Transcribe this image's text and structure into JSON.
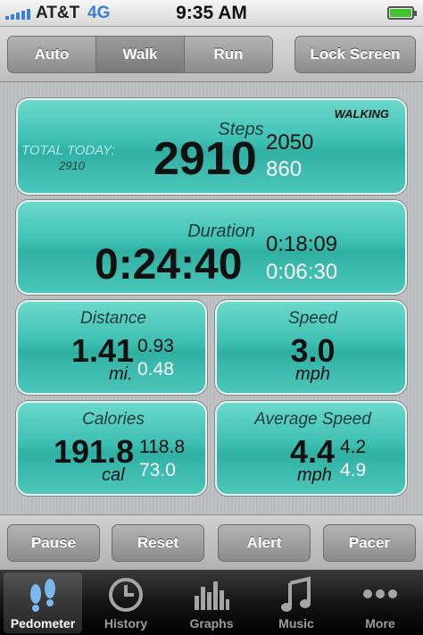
{
  "status_bar": {
    "carrier": "AT&T",
    "network": "4G",
    "time": "9:35 AM",
    "battery_level": 1.0
  },
  "mode_selector": {
    "options": [
      "Auto",
      "Walk",
      "Run"
    ],
    "selected": "Walk"
  },
  "lock_screen_label": "Lock Screen",
  "steps": {
    "label": "Steps",
    "status": "WALKING",
    "total_today_label": "TOTAL TODAY:",
    "total_today_value": "2910",
    "value": "2910",
    "sub_dark": "2050",
    "sub_light": "860"
  },
  "duration": {
    "label": "Duration",
    "value": "0:24:40",
    "sub_dark": "0:18:09",
    "sub_light": "0:06:30"
  },
  "distance": {
    "label": "Distance",
    "value": "1.41",
    "unit": "mi.",
    "sub_dark": "0.93",
    "sub_light": "0.48"
  },
  "speed": {
    "label": "Speed",
    "value": "3.0",
    "unit": "mph"
  },
  "calories": {
    "label": "Calories",
    "value": "191.8",
    "unit": "cal",
    "sub_dark": "118.8",
    "sub_light": "73.0"
  },
  "average_speed": {
    "label": "Average Speed",
    "value": "4.4",
    "unit": "mph",
    "sub_dark": "4.2",
    "sub_light": "4.9"
  },
  "actions": {
    "pause": "Pause",
    "reset": "Reset",
    "alert": "Alert",
    "pacer": "Pacer"
  },
  "tabs": [
    {
      "label": "Pedometer",
      "icon": "footprints-icon"
    },
    {
      "label": "History",
      "icon": "clock-icon"
    },
    {
      "label": "Graphs",
      "icon": "bar-graph-icon"
    },
    {
      "label": "Music",
      "icon": "music-note-icon"
    },
    {
      "label": "More",
      "icon": "more-dots-icon"
    }
  ],
  "active_tab": "Pedometer",
  "colors": {
    "card_teal": "#3dbfb2",
    "accent_blue": "#3b7fd6",
    "battery_green": "#43c22e"
  }
}
